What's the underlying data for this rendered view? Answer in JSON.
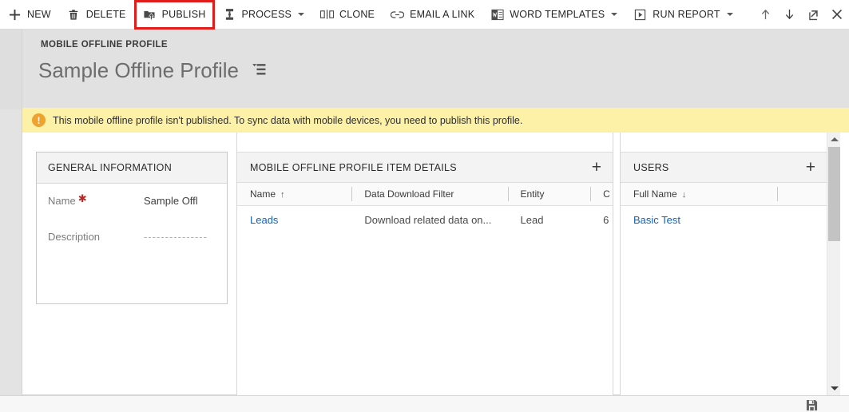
{
  "commandbar": {
    "items": [
      {
        "label": "NEW",
        "icon": "plus-icon",
        "caret": false,
        "highlighted": false
      },
      {
        "label": "DELETE",
        "icon": "trash-icon",
        "caret": false,
        "highlighted": false
      },
      {
        "label": "PUBLISH",
        "icon": "publish-icon",
        "caret": false,
        "highlighted": true
      },
      {
        "label": "PROCESS",
        "icon": "process-icon",
        "caret": true,
        "highlighted": false
      },
      {
        "label": "CLONE",
        "icon": "clone-icon",
        "caret": false,
        "highlighted": false
      },
      {
        "label": "EMAIL A LINK",
        "icon": "link-icon",
        "caret": false,
        "highlighted": false
      },
      {
        "label": "WORD TEMPLATES",
        "icon": "word-icon",
        "caret": true,
        "highlighted": false
      },
      {
        "label": "RUN REPORT",
        "icon": "report-icon",
        "caret": true,
        "highlighted": false
      }
    ],
    "right_icons": [
      {
        "name": "previous-record-icon",
        "glyph": "↑"
      },
      {
        "name": "next-record-icon",
        "glyph": "↓"
      },
      {
        "name": "popout-icon",
        "glyph": "↗"
      },
      {
        "name": "close-icon",
        "glyph": "✕"
      }
    ],
    "highlight_color": "#e21b1b"
  },
  "header": {
    "breadcrumb": "MOBILE OFFLINE PROFILE",
    "title": "Sample Offline Profile",
    "form_selector_icon": "form-selector-icon"
  },
  "notification": {
    "icon": "warning-icon",
    "glyph": "!",
    "message": "This mobile offline profile isn't published. To sync data with mobile devices, you need to publish this profile.",
    "background": "#fdf1a8",
    "icon_color": "#f0a22e"
  },
  "general_information": {
    "title": "GENERAL INFORMATION",
    "fields": [
      {
        "label": "Name",
        "required": true,
        "value": "Sample Offl"
      },
      {
        "label": "Description",
        "required": false,
        "value": "---------------"
      }
    ]
  },
  "profile_item_details": {
    "title": "MOBILE OFFLINE PROFILE ITEM DETAILS",
    "add_label": "+",
    "columns": [
      {
        "label": "Name",
        "sort": "↑"
      },
      {
        "label": "Data Download Filter",
        "sort": ""
      },
      {
        "label": "Entity",
        "sort": ""
      },
      {
        "label": "C",
        "sort": ""
      }
    ],
    "rows": [
      {
        "name": "Leads",
        "filter": "Download related data on...",
        "entity": "Lead",
        "extra": "6"
      }
    ]
  },
  "users": {
    "title": "USERS",
    "add_label": "+",
    "columns": [
      {
        "label": "Full Name",
        "sort": "↓"
      },
      {
        "label": "",
        "sort": ""
      }
    ],
    "rows": [
      {
        "full_name": "Basic Test"
      }
    ]
  },
  "footer": {
    "save_icon": "save-disk-icon"
  },
  "scrollbar": {
    "up_icon": "scroll-up-arrow-icon",
    "down_icon": "scroll-down-arrow-icon",
    "thumb": "scroll-thumb"
  }
}
